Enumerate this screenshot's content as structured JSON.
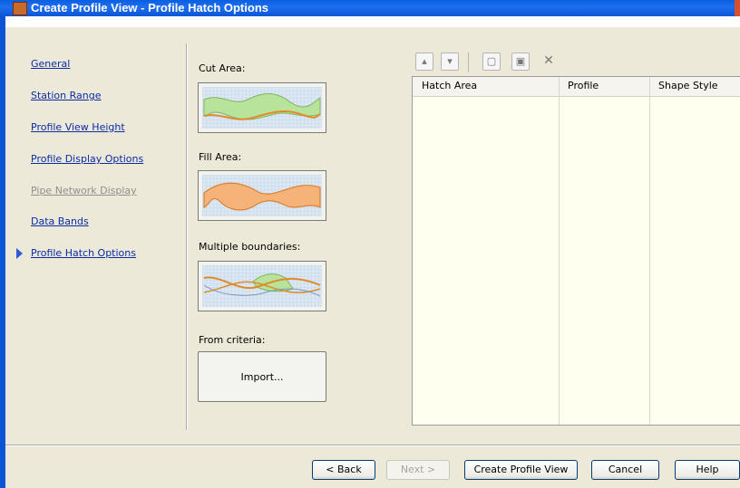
{
  "window": {
    "title": "Create Profile View - Profile Hatch Options"
  },
  "nav": {
    "items": [
      {
        "label": "General",
        "state": "link"
      },
      {
        "label": "Station Range",
        "state": "link"
      },
      {
        "label": "Profile View Height",
        "state": "link"
      },
      {
        "label": "Profile Display Options",
        "state": "link"
      },
      {
        "label": "Pipe Network Display",
        "state": "disabled"
      },
      {
        "label": "Data Bands",
        "state": "link"
      },
      {
        "label": "Profile Hatch Options",
        "state": "current"
      }
    ]
  },
  "hatch": {
    "cut_area_label": "Cut Area:",
    "fill_area_label": "Fill Area:",
    "multiple_boundaries_label": "Multiple boundaries:",
    "from_criteria_label": "From criteria:",
    "import_button": "Import..."
  },
  "toolbar": {
    "buttons": [
      "move-up-icon",
      "move-down-icon",
      "add-hatch-icon",
      "edit-hatch-icon",
      "delete-icon"
    ]
  },
  "grid": {
    "columns": [
      "Hatch Area",
      "Profile",
      "Shape Style"
    ],
    "rows": []
  },
  "footer": {
    "back_label": "< Back",
    "next_label": "Next >",
    "create_label": "Create Profile View",
    "cancel_label": "Cancel",
    "help_label": "Help"
  },
  "colors": {
    "title_blue": "#0b55d4",
    "link_blue": "#0b2ca8",
    "cut_green": "#b8e39a",
    "fill_orange": "#f5b37a",
    "grid_bg": "#fffff0"
  }
}
